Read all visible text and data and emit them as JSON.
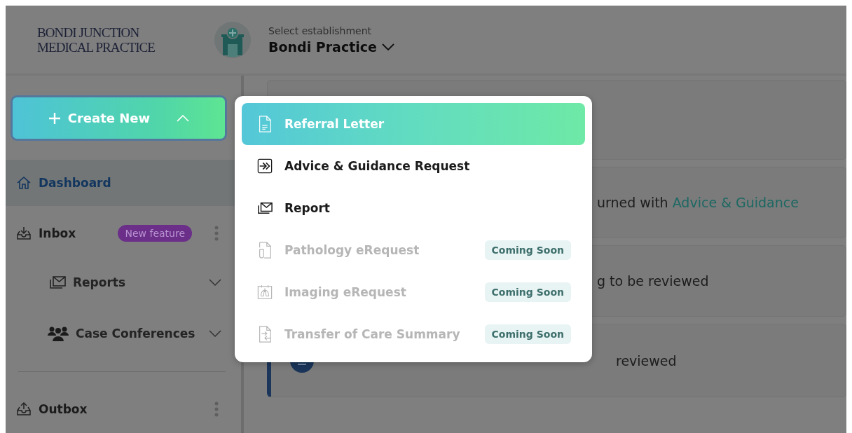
{
  "logo": {
    "line_1": "BONDI JUNCTION",
    "line_2": "MEDICAL PRACTICE"
  },
  "establishment": {
    "label": "Select establishment",
    "value": "Bondi Practice"
  },
  "create_button": {
    "label": "Create New",
    "expanded": true
  },
  "sidebar": {
    "items": [
      {
        "label": "Dashboard",
        "kind": "home",
        "selected": true,
        "actions": false
      },
      {
        "label": "Inbox",
        "kind": "inbox",
        "selected": false,
        "actions": true,
        "badge": "New feature",
        "children": [
          {
            "label": "Reports",
            "kind": "reports",
            "expanded": false
          },
          {
            "label": "Case Conferences",
            "kind": "people",
            "expanded": false
          }
        ]
      },
      {
        "label": "Outbox",
        "kind": "outbox",
        "selected": false,
        "actions": true
      }
    ]
  },
  "notifications": [
    {
      "kind": "partial",
      "text": "urned with ",
      "link": "Advice & Guidance"
    },
    {
      "kind": "partial",
      "text": "g to be reviewed"
    },
    {
      "kind": "unread",
      "text": "reviewed"
    }
  ],
  "create_menu": {
    "items": [
      {
        "label": "Referral Letter",
        "kind": "document",
        "selected": true,
        "disabled": false
      },
      {
        "label": "Advice & Guidance Request",
        "kind": "forward",
        "selected": false,
        "disabled": false
      },
      {
        "label": "Report",
        "kind": "reports",
        "selected": false,
        "disabled": false
      },
      {
        "label": "Pathology eRequest",
        "kind": "tube",
        "selected": false,
        "disabled": true,
        "badge": "Coming Soon"
      },
      {
        "label": "Imaging eRequest",
        "kind": "lungs",
        "selected": false,
        "disabled": true,
        "badge": "Coming Soon"
      },
      {
        "label": "Transfer of Care Summary",
        "kind": "transfer",
        "selected": false,
        "disabled": true,
        "badge": "Coming Soon"
      }
    ]
  }
}
